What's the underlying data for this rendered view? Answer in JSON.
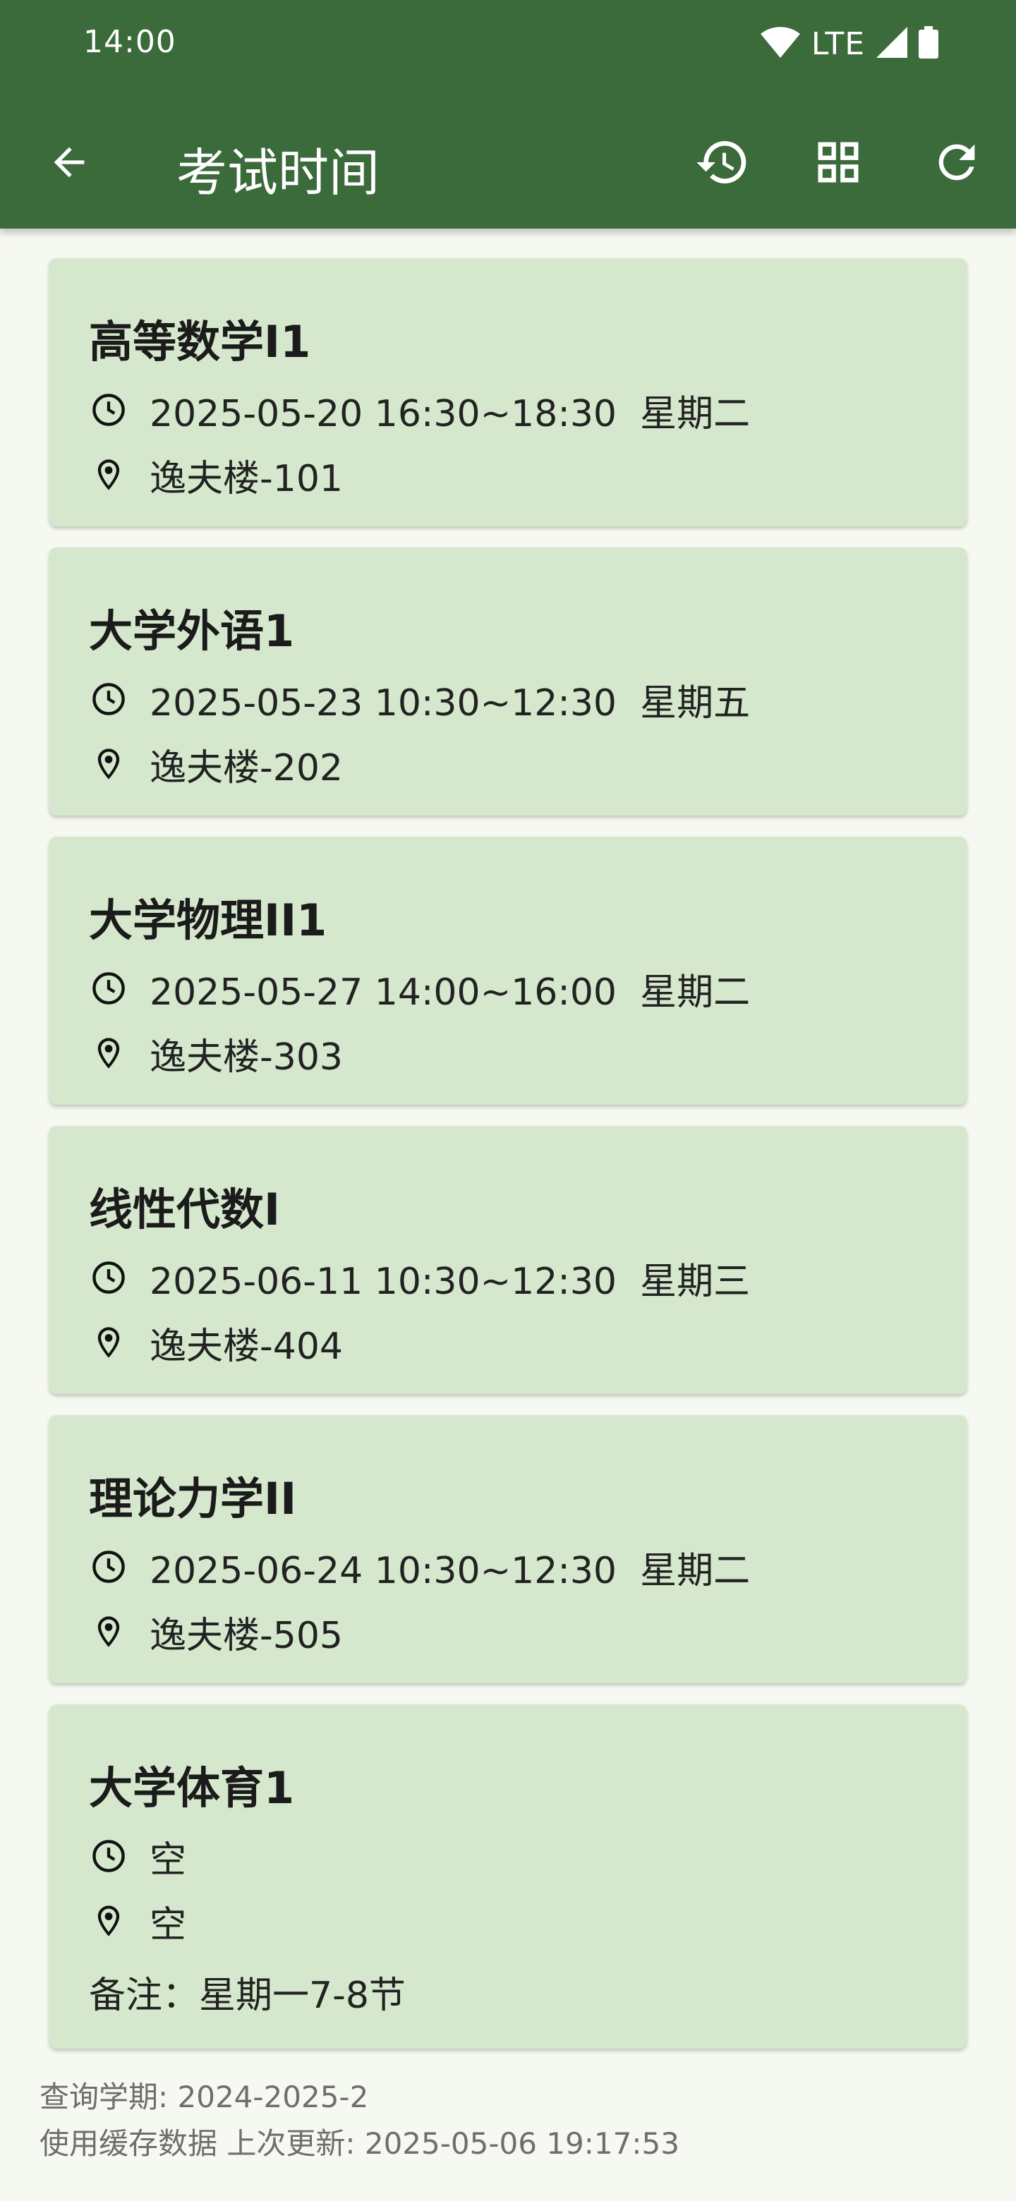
{
  "status": {
    "time": "14:00",
    "network": "LTE"
  },
  "toolbar": {
    "title": "考试时间",
    "icons": [
      "back-arrow-icon",
      "history-icon",
      "grid-icon",
      "refresh-icon"
    ]
  },
  "exams": [
    {
      "name": "高等数学I1",
      "time": "2025-05-20 16:30~18:30  星期二",
      "location": "逸夫楼-101"
    },
    {
      "name": "大学外语1",
      "time": "2025-05-23 10:30~12:30  星期五",
      "location": "逸夫楼-202"
    },
    {
      "name": "大学物理II1",
      "time": "2025-05-27 14:00~16:00  星期二",
      "location": "逸夫楼-303"
    },
    {
      "name": "线性代数I",
      "time": "2025-06-11 10:30~12:30  星期三",
      "location": "逸夫楼-404"
    },
    {
      "name": "理论力学II",
      "time": "2025-06-24 10:30~12:30  星期二",
      "location": "逸夫楼-505"
    },
    {
      "name": "大学体育1",
      "time": "空",
      "location": "空",
      "note": "备注：星期一7-8节"
    }
  ],
  "footer": {
    "semester": "查询学期: 2024-2025-2",
    "cache": "使用缓存数据 上次更新: 2025-05-06 19:17:53"
  },
  "colors": {
    "appbar": "#3b6a3b",
    "card": "#d5e8cd",
    "background": "#f6f9f1"
  }
}
